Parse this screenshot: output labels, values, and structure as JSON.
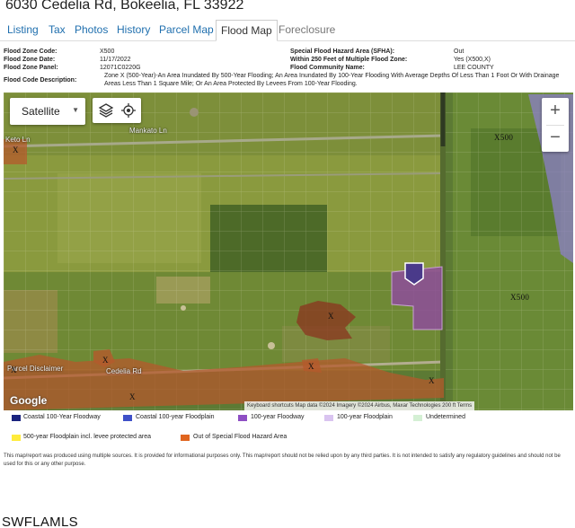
{
  "property": {
    "address": "6030 Cedelia Rd, Bokeelia, FL 33922"
  },
  "tabs": [
    {
      "label": "Listing"
    },
    {
      "label": "Tax"
    },
    {
      "label": "Photos"
    },
    {
      "label": "History"
    },
    {
      "label": "Parcel Map"
    },
    {
      "label": "Flood Map"
    },
    {
      "label": "Foreclosure"
    }
  ],
  "flood_info": {
    "zone_code": {
      "label": "Flood Zone Code:",
      "value": "X500"
    },
    "zone_date": {
      "label": "Flood Zone Date:",
      "value": "11/17/2022"
    },
    "zone_panel": {
      "label": "Flood Zone Panel:",
      "value": "12071C0220G"
    },
    "code_description": {
      "label": "Flood Code Description:",
      "value": "Zone X (500-Year)-An Area Inundated By 500-Year Flooding; An Area Inundated By 100-Year Flooding With Average Depths Of Less Than 1 Foot Or With Drainage Areas Less Than 1 Square Mile; Or An Area Protected By Levees From 100-Year Flooding."
    },
    "sfha": {
      "label": "Special Flood Hazard Area (SFHA):",
      "value": "Out"
    },
    "within_250": {
      "label": "Within 250 Feet of Multiple Flood Zone:",
      "value": "Yes (X500,X)"
    },
    "community": {
      "label": "Flood Community Name:",
      "value": "LEE COUNTY"
    }
  },
  "map": {
    "map_type": "Satellite",
    "zoom_in": "+",
    "zoom_out": "−",
    "labels": {
      "mankato": "Mankato Ln",
      "keto": "Keto Ln",
      "cedelia": "Cedelia Rd",
      "parcel": "Parcel Disclaimer"
    },
    "zone_labels": {
      "x500": "X500",
      "x": "X"
    },
    "google": "Google",
    "attribution": "Keyboard shortcuts   Map data ©2024 Imagery ©2024 Airbus, Maxar Technologies   200 ft   Terms"
  },
  "legend": [
    {
      "label": "Coastal 100-Year Floodway",
      "color": "#1a237e"
    },
    {
      "label": "Coastal 100-year Floodplain",
      "color": "#3f51c8"
    },
    {
      "label": "100-year Floodway",
      "color": "#8e4fc4"
    },
    {
      "label": "100-year Floodplain",
      "color": "#d9c4f0"
    },
    {
      "label": "Undetermined",
      "color": "#d4f0d4"
    },
    {
      "label": "500-year Floodplain incl. levee protected area",
      "color": "#ffeb3b"
    },
    {
      "label": "Out of Special Flood Hazard Area",
      "color": "#e0651f"
    }
  ],
  "disclaimer": "This map/report was produced using multiple sources. It is provided for informational purposes only. This map/report should not be relied upon by any third parties. It is not intended to satisfy any regulatory guidelines and should not be used for this or any other purpose.",
  "watermark": "SWFLAMLS"
}
